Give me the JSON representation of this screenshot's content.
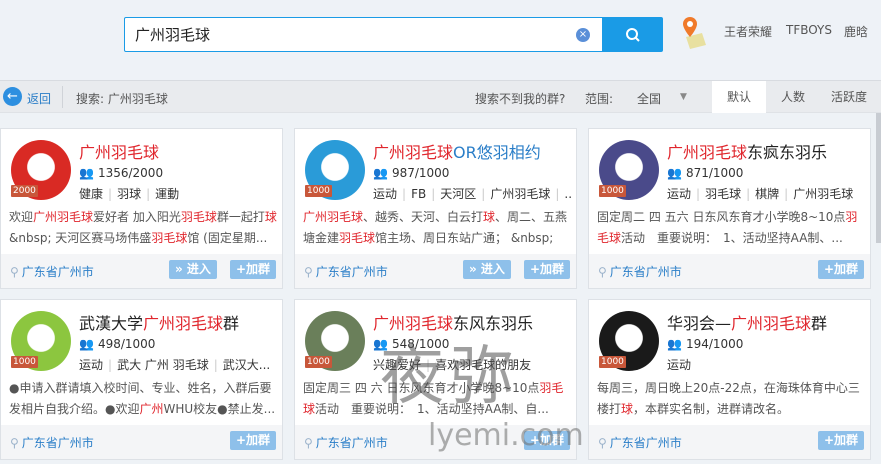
{
  "search": {
    "value": "广州羽毛球",
    "clear_icon": "×"
  },
  "hot": [
    "王者荣耀",
    "TFBOYS",
    "鹿晗"
  ],
  "filterbar": {
    "back": "返回",
    "query": "搜索: 广州羽毛球",
    "not_found": "搜索不到我的群?",
    "scope_label": "范围:",
    "scope_value": "全国",
    "tabs": [
      "默认",
      "人数",
      "活跃度"
    ],
    "active_tab": "默认"
  },
  "colors": {
    "accent": "#1a9be6",
    "highlight": "#e0262d",
    "link": "#2a7ec8"
  },
  "cards": [
    {
      "title": [
        {
          "t": "广州羽毛球",
          "h": true
        }
      ],
      "badge": "2000",
      "count": "1356/2000",
      "tags": [
        "健康",
        "羽球",
        "運動"
      ],
      "desc": [
        {
          "t": "欢迎"
        },
        {
          "t": "广州羽毛球",
          "h": true
        },
        {
          "t": "爱好者 加入阳光"
        },
        {
          "t": "羽毛球",
          "h": true
        },
        {
          "t": "群一起打"
        },
        {
          "t": "球",
          "h": true
        },
        {
          "t": "&nbsp; 天河区赛马场伟盛"
        },
        {
          "t": "羽毛球",
          "h": true
        },
        {
          "t": "馆 (固定星期..."
        }
      ],
      "location": "广东省广州市",
      "enter": "» 进入",
      "join": "+加群",
      "avatar": "#d92a24"
    },
    {
      "title": [
        {
          "t": "广州羽毛球",
          "h": true
        },
        {
          "t": "OR悠羽相约",
          "b": true
        }
      ],
      "badge": "1000",
      "count": "987/1000",
      "tags": [
        "运动",
        "FB",
        "天河区",
        "广州羽毛球",
        "..."
      ],
      "desc": [
        {
          "t": "广州羽毛球",
          "h": true
        },
        {
          "t": "、越秀、天河、白云打"
        },
        {
          "t": "球",
          "h": true
        },
        {
          "t": "、周二、五燕塘金建"
        },
        {
          "t": "羽毛球",
          "h": true
        },
        {
          "t": "馆主场、周日东站广通； &nbsp; -..."
        }
      ],
      "location": "广东省广州市",
      "enter": "» 进入",
      "join": "+加群",
      "avatar": "#2a9bd8"
    },
    {
      "title": [
        {
          "t": "广州羽毛球",
          "h": true
        },
        {
          "t": "东疯东羽乐"
        }
      ],
      "badge": "1000",
      "count": "871/1000",
      "tags": [
        "运动",
        "羽毛球",
        "棋牌",
        "广州羽毛球"
      ],
      "desc": [
        {
          "t": "固定周二 四 五六 日东风东育才小学晚8~10点"
        },
        {
          "t": "羽毛球",
          "h": true
        },
        {
          "t": "活动　重要说明：　1、活动坚持AA制、..."
        }
      ],
      "location": "广东省广州市",
      "join": "+加群",
      "avatar": "#4a4a8a"
    },
    {
      "title": [
        {
          "t": "武漢大学"
        },
        {
          "t": "广州羽毛球",
          "h": true
        },
        {
          "t": "群"
        }
      ],
      "badge": "1000",
      "count": "498/1000",
      "tags": [
        "运动",
        "武大 广州  羽毛球",
        "武汉大..."
      ],
      "desc": [
        {
          "t": "●申请入群请填入校时间、专业、姓名，入群后要发相片自我介绍。●欢迎"
        },
        {
          "t": "广州",
          "h": true
        },
        {
          "t": "WHU校友●禁止发..."
        }
      ],
      "location": "广东省广州市",
      "join": "+加群",
      "avatar": "#8cc63f"
    },
    {
      "title": [
        {
          "t": "广州羽毛球",
          "h": true
        },
        {
          "t": "东风东羽乐"
        }
      ],
      "badge": "1000",
      "count": "548/1000",
      "tags": [
        "兴趣爱好",
        "喜欢羽毛球的朋友"
      ],
      "desc": [
        {
          "t": "固定周三 四 六 日东风东育才小学晚8~10点"
        },
        {
          "t": "羽毛球",
          "h": true
        },
        {
          "t": "活动　重要说明：　1、活动坚持AA制、自..."
        }
      ],
      "location": "广东省广州市",
      "join": "+加群",
      "avatar": "#6a7f5a"
    },
    {
      "title": [
        {
          "t": "华羽会—"
        },
        {
          "t": "广州羽毛球",
          "h": true
        },
        {
          "t": "群"
        }
      ],
      "badge": "1000",
      "count": "194/1000",
      "tags": [
        "运动"
      ],
      "desc": [
        {
          "t": "每周三，周日晚上20点-22点，在海珠体育中心三楼打"
        },
        {
          "t": "球",
          "h": true
        },
        {
          "t": "，本群实名制，进群请改名。"
        }
      ],
      "location": "广东省广州市",
      "join": "+加群",
      "avatar": "#1a1a1a"
    }
  ],
  "watermark": {
    "cn": "夜弥",
    "url": "lyemi.com"
  }
}
